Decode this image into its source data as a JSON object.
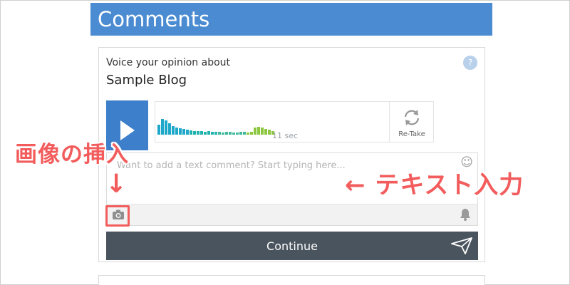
{
  "header": {
    "title": "Comments"
  },
  "card": {
    "prompt_label": "Voice your opinion about",
    "blog_title": "Sample Blog",
    "help_icon": "?",
    "recorder": {
      "duration": "11 sec",
      "retake_label": "Re-Take",
      "waveform_levels": [
        0.35,
        0.55,
        0.5,
        0.4,
        0.3,
        0.25,
        0.22,
        0.2,
        0.18,
        0.15,
        0.13,
        0.12,
        0.12,
        0.1,
        0.12,
        0.1,
        0.1,
        0.1,
        0.08,
        0.1,
        0.1,
        0.08,
        0.08,
        0.1,
        0.1,
        0.08,
        0.1,
        0.25,
        0.28,
        0.25,
        0.2,
        0.18,
        0.12
      ],
      "waveform_colors": [
        "#1fa8c9",
        "#22b3b0",
        "#41b99a",
        "#8cc63f"
      ]
    },
    "comment": {
      "placeholder": "Want to add a text comment? Start typing here...",
      "value": ""
    },
    "continue_label": "Continue"
  },
  "annotations": {
    "insert_image": "画像の挿入",
    "down_arrow": "↓",
    "text_input": "← テキスト入力",
    "color": "#f35c5c"
  },
  "colors": {
    "header_bg": "#4a8bd2",
    "play_bg": "#3d7fca",
    "continue_bg": "#4a545e"
  }
}
